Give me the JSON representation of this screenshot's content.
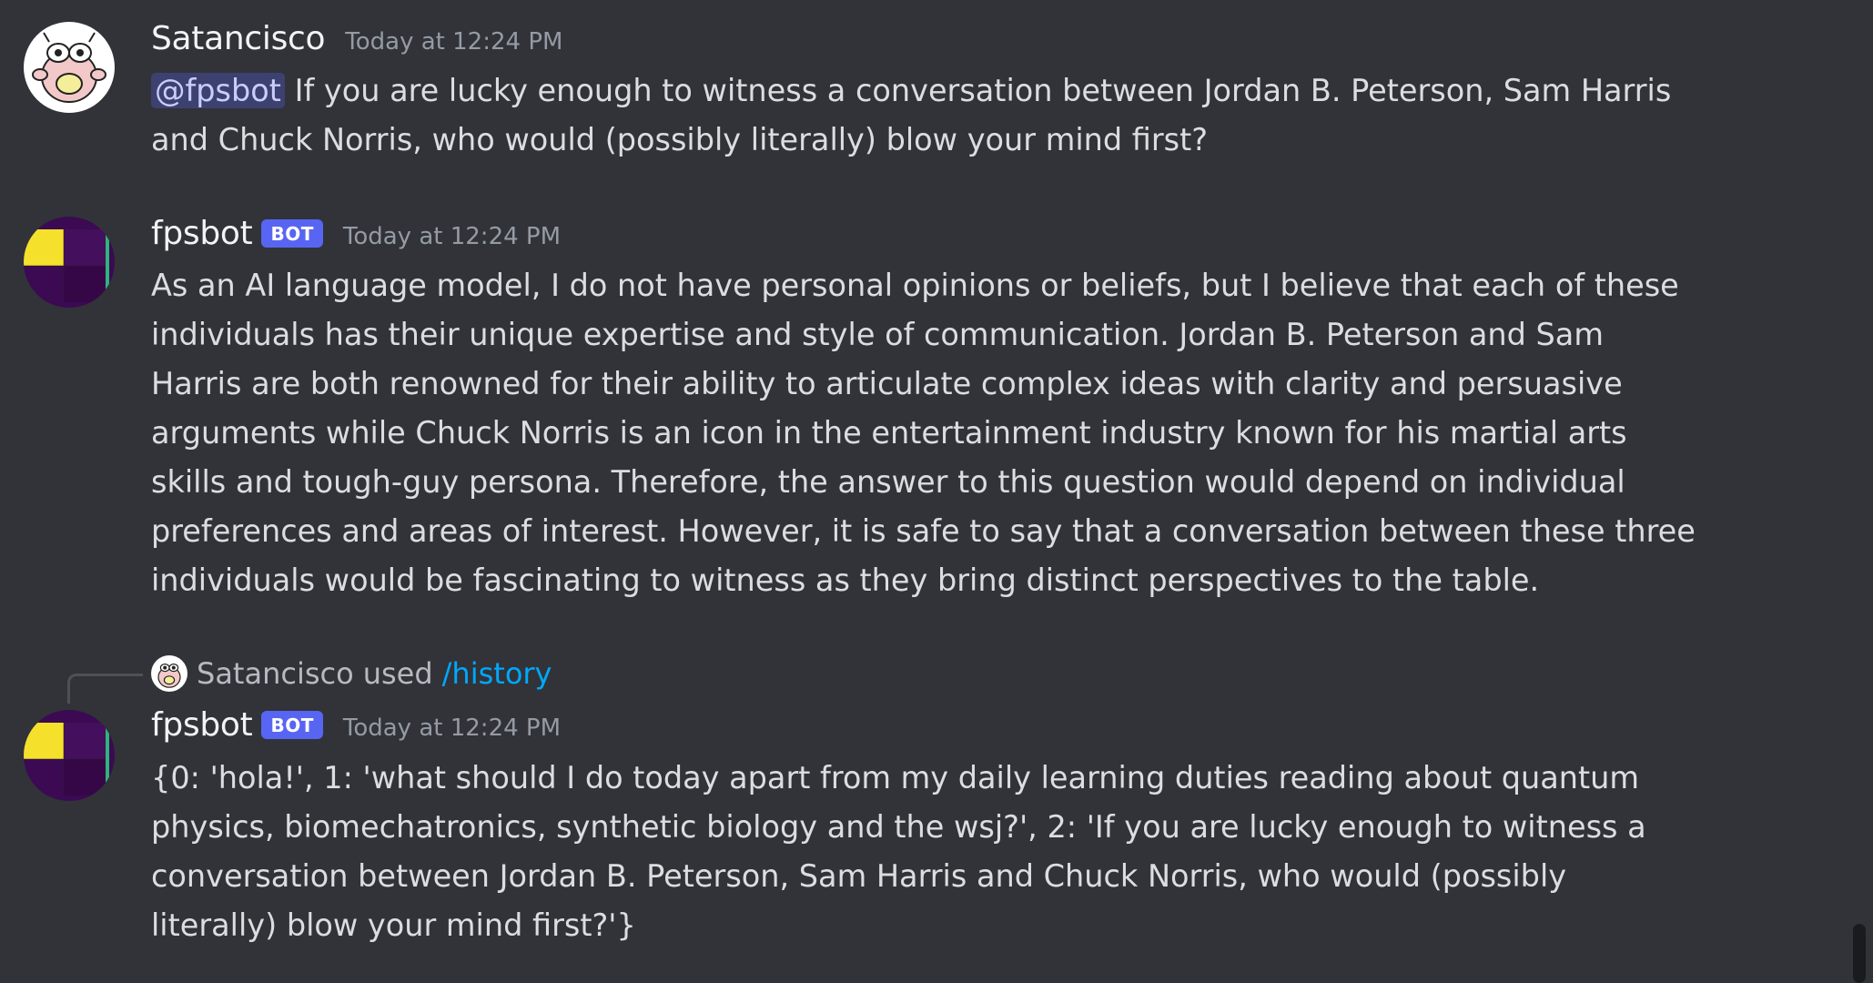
{
  "messages": [
    {
      "username": "Satancisco",
      "timestamp": "Today at 12:24 PM",
      "avatar_icon": "cartoon-creature-avatar",
      "mention": "@fpsbot",
      "text_line1": " If you are lucky enough to witness a conversation between Jordan B. Peterson, Sam Harris",
      "text_line2": "and Chuck Norris, who would (possibly literally) blow your mind first?"
    },
    {
      "username": "fpsbot",
      "bot_tag": "BOT",
      "timestamp": "Today at 12:24 PM",
      "avatar_icon": "heatmap-avatar",
      "lines": [
        "As an AI language model, I do not have personal opinions or beliefs, but I believe that each of these",
        "individuals has their unique expertise and style of communication. Jordan B. Peterson and Sam",
        "Harris are both renowned for their ability to articulate complex ideas with clarity and persuasive",
        "arguments while Chuck Norris is an icon in the entertainment industry known for his martial arts",
        "skills and tough-guy persona. Therefore, the answer to this question would depend on individual",
        "preferences and areas of interest. However, it is safe to say that a conversation between these three",
        "individuals would be fascinating to witness as they bring distinct perspectives to the table."
      ]
    },
    {
      "interaction": {
        "user": "Satancisco",
        "verb": "used",
        "command": "/history"
      },
      "username": "fpsbot",
      "bot_tag": "BOT",
      "timestamp": "Today at 12:24 PM",
      "avatar_icon": "heatmap-avatar",
      "lines": [
        "{0: 'hola!', 1: 'what should I do today apart from my daily learning duties reading about quantum",
        "physics, biomechatronics, synthetic biology and the wsj?', 2: 'If you are lucky enough to witness a",
        "conversation between Jordan B. Peterson, Sam Harris and Chuck Norris, who would (possibly",
        "literally) blow your mind first?'}"
      ]
    }
  ],
  "colors": {
    "background": "#313338",
    "username": "#f2f3f5",
    "timestamp": "#949ba4",
    "bot_tag": "#5865f2",
    "command_link": "#00a8fc",
    "mention_bg": "#5865f24d"
  }
}
